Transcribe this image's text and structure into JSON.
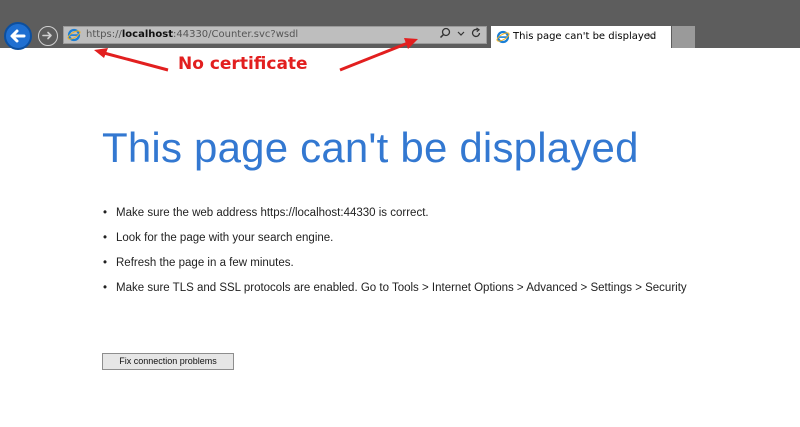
{
  "browser": {
    "address_bar": {
      "url_prefix": "https://",
      "url_host": "localhost",
      "url_rest": ":44330/Counter.svc?wsdl",
      "search_icon": "magnifier-icon",
      "dropdown_icon": "chevron-down-icon",
      "refresh_icon": "refresh-icon"
    },
    "tab": {
      "title": "This page can't be displayed",
      "close_glyph": "×"
    }
  },
  "annotation": {
    "label": "No certificate",
    "color": "#e21f1f"
  },
  "error_page": {
    "title": "This page can't be displayed",
    "tips": [
      "Make sure the web address https://localhost:44330 is correct.",
      "Look for the page with your search engine.",
      "Refresh the page in a few minutes.",
      "Make sure TLS and SSL protocols are enabled. Go to Tools > Internet Options > Advanced > Settings > Security"
    ],
    "fix_button_label": "Fix connection problems",
    "title_color": "#3378d1"
  }
}
